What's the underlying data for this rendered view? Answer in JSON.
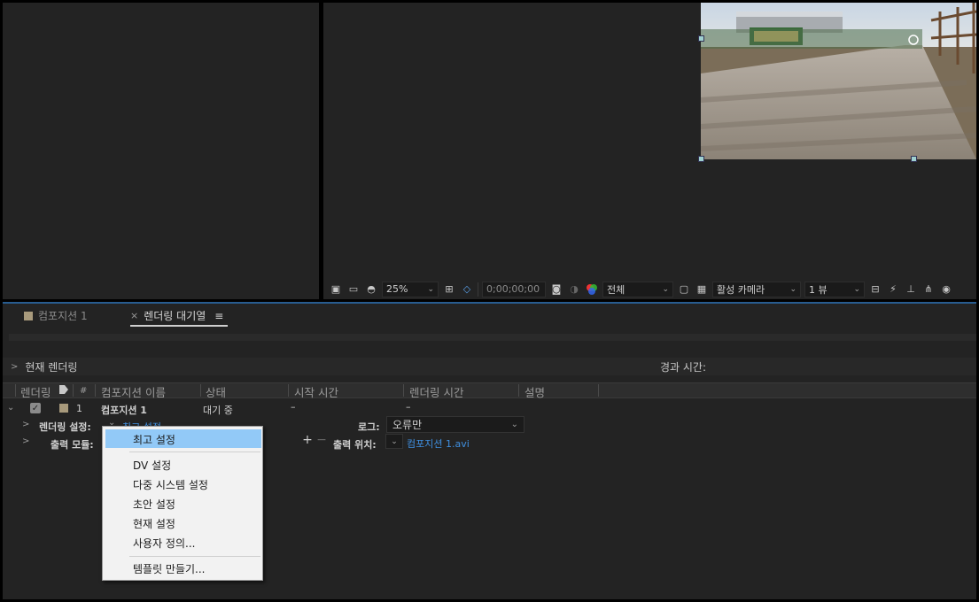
{
  "viewer": {
    "zoom": "25%",
    "timecode": "0;00;00;00",
    "resolution": "전체",
    "camera": "활성 카메라",
    "views": "1 뷰"
  },
  "tabs": [
    {
      "label": "컴포지션 1"
    },
    {
      "label": "렌더링 대기열",
      "close": "×",
      "menu": "≡"
    }
  ],
  "queue": {
    "current_render": "현재 렌더링",
    "elapsed": "경과 시간:",
    "headers": {
      "render": "렌더링",
      "num": "#",
      "comp_name": "컴포지션 이름",
      "status": "상태",
      "start_time": "시작 시간",
      "render_time": "렌더링 시간",
      "comment": "설명"
    },
    "item": {
      "num": "1",
      "comp_name": "컴포지션 1",
      "status": "대기 중",
      "start_time": "–",
      "render_time": "–"
    },
    "render_settings_label": "렌더링 설정:",
    "render_settings_value": "최고 설정",
    "output_module_label": "출력 모듈:",
    "log_label": "로그:",
    "log_value": "오류만",
    "output_to_label": "출력 위치:",
    "output_to_value": "컴포지션 1.avi"
  },
  "context_menu": {
    "items": [
      "최고 설정",
      "DV 설정",
      "다중 시스템 설정",
      "초안 설정",
      "현재 설정",
      "사용자 정의...",
      "템플릿 만들기..."
    ]
  },
  "colors": {
    "panel": "#232323",
    "accent": "#2d8ceb",
    "menu_highlight": "#92c9f7",
    "link": "#3f8fe0"
  }
}
